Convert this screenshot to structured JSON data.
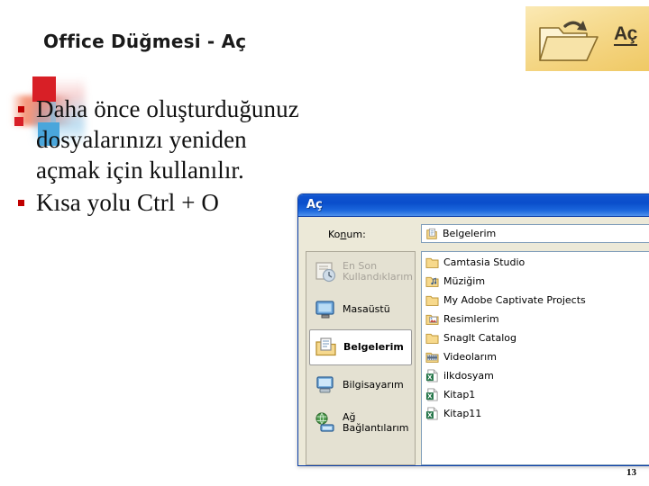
{
  "slide": {
    "title": "Office Düğmesi - Aç",
    "page_number": "13",
    "bullets": [
      {
        "text": "Daha önce oluşturduğunuz dosyalarınızı yeniden açmak için kullanılır."
      },
      {
        "text": "Kısa yolu Ctrl + O"
      }
    ],
    "bullet_color": "#c00000"
  },
  "banner": {
    "icon_name": "open-folder-icon",
    "label": "Aç",
    "background_start": "#fbe9b4",
    "background_end": "#efc964"
  },
  "dialog": {
    "title": "Aç",
    "titlebar_color": "#0a4ecb",
    "lookin": {
      "label_before": "Ko",
      "label_accel": "n",
      "label_after": "um:",
      "value": "Belgelerim",
      "icon_name": "my-documents-icon"
    },
    "places": [
      {
        "label": "En Son\nKullandıklarım",
        "icon": "recent-documents-icon",
        "state": "disabled"
      },
      {
        "label": "Masaüstü",
        "icon": "desktop-icon",
        "state": "normal"
      },
      {
        "label": "Belgelerim",
        "icon": "my-documents-icon",
        "state": "selected"
      },
      {
        "label": "Bilgisayarım",
        "icon": "my-computer-icon",
        "state": "normal"
      },
      {
        "label": "Ağ\nBağlantılarım",
        "icon": "network-places-icon",
        "state": "normal"
      }
    ],
    "files": [
      {
        "name": "Camtasia Studio",
        "icon": "folder-icon"
      },
      {
        "name": "Müziğim",
        "icon": "music-folder-icon"
      },
      {
        "name": "My Adobe Captivate Projects",
        "icon": "folder-icon"
      },
      {
        "name": "Resimlerim",
        "icon": "pictures-folder-icon"
      },
      {
        "name": "SnagIt Catalog",
        "icon": "folder-icon"
      },
      {
        "name": "Videolarım",
        "icon": "video-folder-icon"
      },
      {
        "name": "ilkdosyam",
        "icon": "excel-file-icon"
      },
      {
        "name": "Kitap1",
        "icon": "excel-file-icon"
      },
      {
        "name": "Kitap11",
        "icon": "excel-file-icon"
      }
    ]
  }
}
